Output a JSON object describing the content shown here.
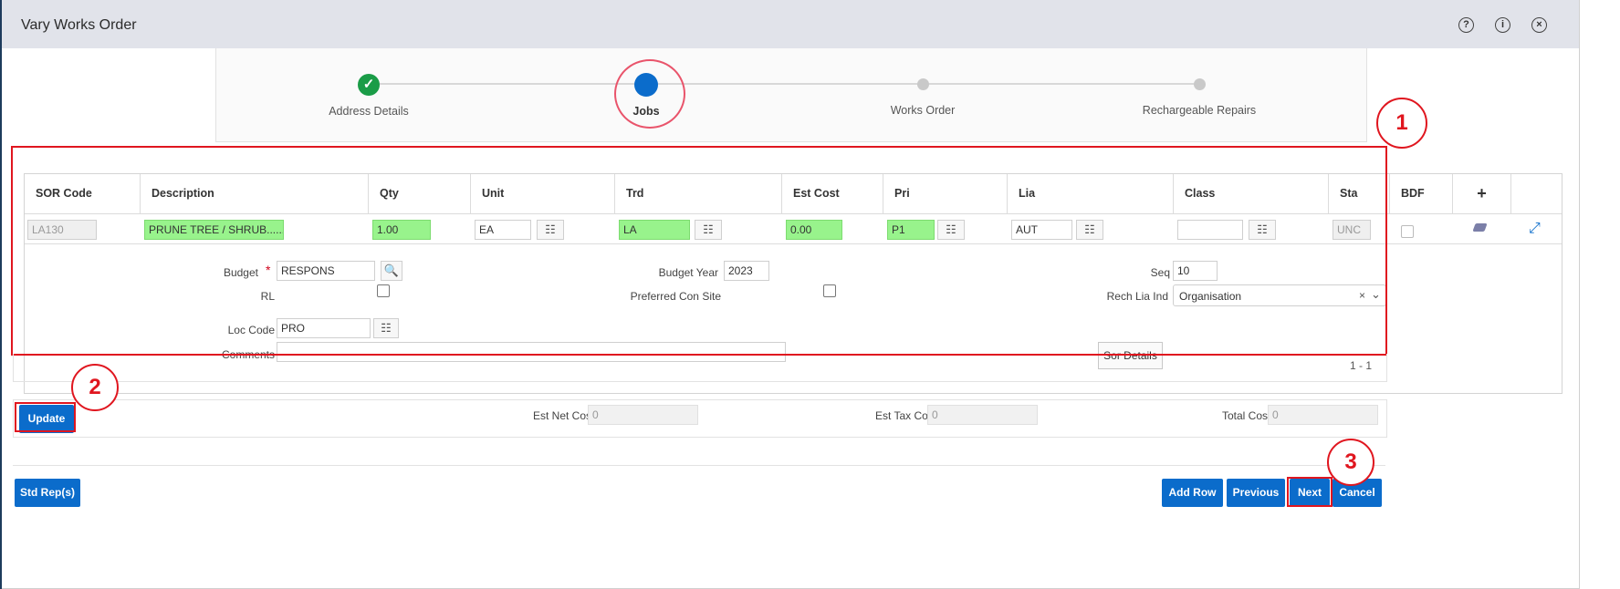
{
  "dialog": {
    "title": "Vary Works Order"
  },
  "titlebar_icons": [
    "help-icon",
    "info-icon",
    "close-icon"
  ],
  "wizard": {
    "steps": [
      {
        "label": "Address Details",
        "state": "done"
      },
      {
        "label": "Jobs",
        "state": "current"
      },
      {
        "label": "Works Order",
        "state": "future"
      },
      {
        "label": "Rechargeable Repairs",
        "state": "future"
      }
    ]
  },
  "grid": {
    "columns": [
      "SOR Code",
      "Description",
      "Qty",
      "Unit",
      "Trd",
      "Est Cost",
      "Pri",
      "Lia",
      "Class",
      "Sta",
      "BDF"
    ],
    "add_symbol": "+",
    "row": {
      "sor_code": "LA130",
      "description": "PRUNE TREE / SHRUB......(O",
      "qty": "1.00",
      "unit": "EA",
      "trd": "LA",
      "est_cost": "0.00",
      "pri": "P1",
      "lia": "AUT",
      "class": "",
      "sta": "UNC"
    },
    "pagination": "1 - 1"
  },
  "detail": {
    "budget_label": "Budget",
    "required_mark": "*",
    "budget_value": "RESPONS",
    "budget_year_label": "Budget Year",
    "budget_year_value": "2023",
    "seq_label": "Seq",
    "seq_value": "10",
    "rl_label": "RL",
    "preferred_con_site_label": "Preferred Con Site",
    "rech_lia_ind_label": "Rech Lia Ind",
    "rech_lia_ind_value": "Organisation",
    "loc_code_label": "Loc Code",
    "loc_code_value": "PRO",
    "comments_label": "Comments",
    "comments_value": "",
    "sor_details_button": "Sor Details"
  },
  "summary": {
    "update_button": "Update",
    "est_net_cost_label": "Est Net Cost",
    "est_net_cost_value": "0",
    "est_tax_cost_label": "Est Tax Cost",
    "est_tax_cost_value": "0",
    "total_cost_label": "Total Cost",
    "total_cost_value": "0"
  },
  "footer": {
    "std_reps_button": "Std Rep(s)",
    "add_row_button": "Add Row",
    "previous_button": "Previous",
    "next_button": "Next",
    "cancel_button": "Cancel"
  },
  "annotations": [
    "1",
    "2",
    "3"
  ],
  "colors": {
    "primary": "#0b6ccb",
    "required_field": "#98f38c",
    "annotation": "#e0161f",
    "done": "#1a9c47"
  }
}
